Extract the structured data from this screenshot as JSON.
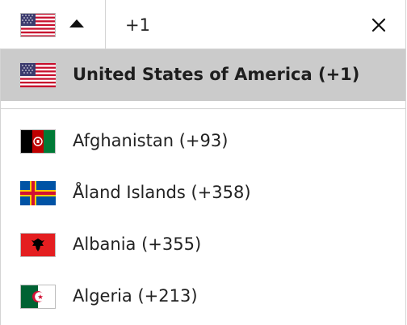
{
  "phone_input": {
    "value": "+1",
    "country_flag_icon": "us-flag-icon"
  },
  "dropdown": {
    "selected": {
      "label": "United States of America (+1)",
      "flag_icon": "us-flag-icon"
    },
    "items": [
      {
        "label": "Afghanistan (+93)",
        "flag_icon": "afghanistan-flag-icon"
      },
      {
        "label": "Åland Islands (+358)",
        "flag_icon": "aland-flag-icon"
      },
      {
        "label": "Albania (+355)",
        "flag_icon": "albania-flag-icon"
      },
      {
        "label": "Algeria (+213)",
        "flag_icon": "algeria-flag-icon"
      }
    ]
  },
  "colors": {
    "selected_background": "#cbcbcb",
    "border": "#d4d4d4",
    "text": "#222222"
  }
}
